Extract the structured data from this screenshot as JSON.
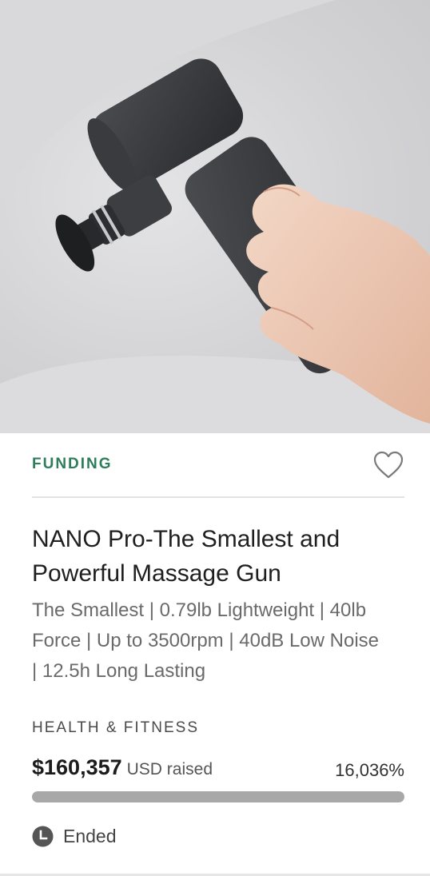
{
  "card": {
    "status": "FUNDING",
    "favorite_icon": "heart-outline-icon",
    "title": "NANO Pro-The Smallest and Powerful Massage Gun",
    "description": "The Smallest | 0.79lb Lightweight | 40lb Force | Up to 3500rpm | 40dB Low Noise | 12.5h Long Lasting",
    "category": "HEALTH & FITNESS",
    "amount": "$160,357",
    "currency_label": "USD raised",
    "percent": "16,036%",
    "progress": 1.0,
    "time_icon": "clock-icon",
    "time_status": "Ended"
  },
  "colors": {
    "status_green": "#2e7d5b",
    "progress_fill": "#a8a8a8",
    "progress_track": "#e8e8e8"
  }
}
